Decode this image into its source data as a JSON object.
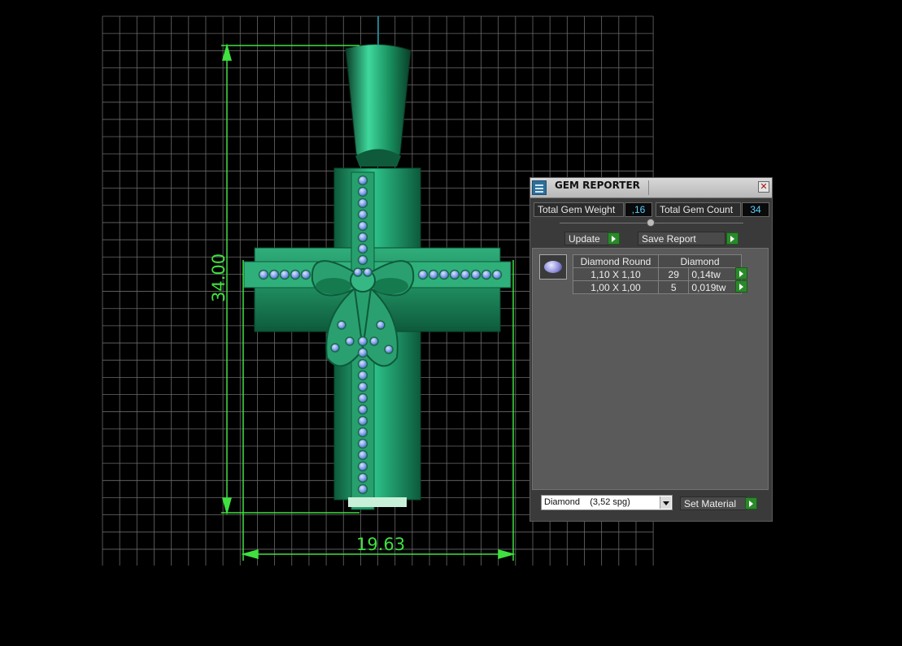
{
  "viewport": {
    "height_dimension": "34.00",
    "width_dimension": "19.63"
  },
  "colors": {
    "grid": "#6a6a6a",
    "dimension": "#3fe03f",
    "metal": "#1f9a68",
    "gem": "#7a9ae8"
  },
  "gem_reporter": {
    "title": "GEM REPORTER",
    "total_gem_weight_label": "Total Gem Weight",
    "total_gem_weight_value": ",16",
    "total_gem_count_label": "Total Gem Count",
    "total_gem_count_value": "34",
    "update_label": "Update",
    "save_report_label": "Save Report",
    "table": {
      "headers": [
        "Diamond Round",
        "Diamond"
      ],
      "rows": [
        {
          "size": "1,10 X 1,10",
          "count": "29",
          "weight": "0,14tw"
        },
        {
          "size": "1,00 X 1,00",
          "count": "5",
          "weight": "0,019tw"
        }
      ]
    },
    "material_value": "Diamond    (3,52 spg)",
    "set_material_label": "Set Material"
  }
}
